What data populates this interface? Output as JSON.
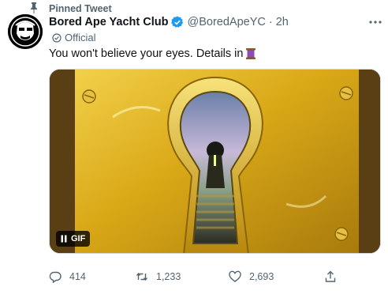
{
  "pinned": {
    "label": "Pinned Tweet"
  },
  "tweet": {
    "display_name": "Bored Ape Yacht Club",
    "handle": "@BoredApeYC",
    "separator": "·",
    "time": "2h",
    "official_label": "Official",
    "text": "You won't believe your eyes. Details in"
  },
  "media": {
    "badge": "GIF"
  },
  "actions": {
    "replies": "414",
    "retweets": "1,233",
    "likes": "2,693"
  },
  "colors": {
    "verified": "#1d9bf0",
    "secondary_text": "#536471",
    "media_gold": "#d4a814"
  },
  "icons": [
    "pin-icon",
    "verified-badge-icon",
    "more-icon",
    "official-badge-icon",
    "spool-emoji",
    "pause-icon",
    "reply-icon",
    "retweet-icon",
    "like-icon",
    "share-icon"
  ]
}
